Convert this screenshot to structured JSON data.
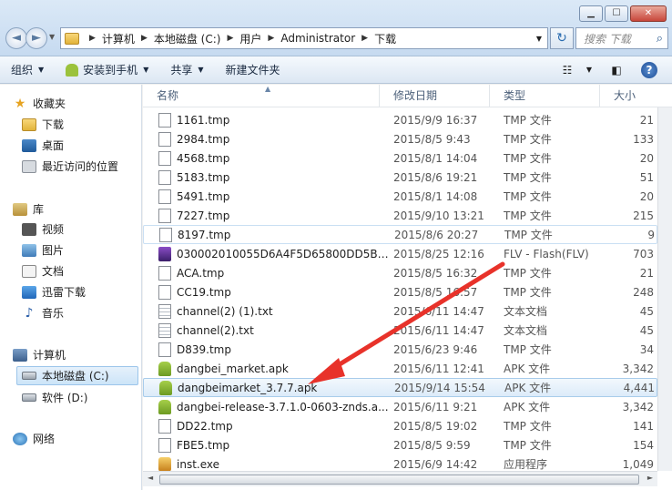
{
  "window": {
    "minimize": "▁",
    "maximize": "☐",
    "close": "✕"
  },
  "address": {
    "back_icon": "◄",
    "forward_icon": "►",
    "crumbs": [
      "计算机",
      "本地磁盘 (C:)",
      "用户",
      "Administrator",
      "下载"
    ],
    "separator": "▶",
    "dropdown": "▼",
    "refresh_icon": "↻",
    "search_placeholder": "搜索 下载",
    "search_icon": "⌕"
  },
  "toolbar": {
    "organize": "组织",
    "install_phone": "安装到手机",
    "share": "共享",
    "new_folder": "新建文件夹",
    "dropdown_arrow": "▼",
    "view_icon": "☷",
    "pane_icon": "◧",
    "help_icon": "?"
  },
  "sidebar": {
    "favorites": "收藏夹",
    "downloads": "下载",
    "desktop": "桌面",
    "recent": "最近访问的位置",
    "libraries": "库",
    "videos": "视频",
    "pictures": "图片",
    "documents": "文档",
    "xunlei": "迅雷下载",
    "music": "音乐",
    "computer": "计算机",
    "drive_c": "本地磁盘 (C:)",
    "drive_d": "软件 (D:)",
    "network": "网络",
    "star_icon": "★",
    "music_icon": "♪"
  },
  "columns": {
    "name": "名称",
    "date": "修改日期",
    "type": "类型",
    "size": "大小",
    "sort": "▲"
  },
  "files": [
    {
      "name": "1161.tmp",
      "date": "2015/9/9 16:37",
      "type": "TMP 文件",
      "size": "21",
      "icon": "tmp"
    },
    {
      "name": "2984.tmp",
      "date": "2015/8/5 9:43",
      "type": "TMP 文件",
      "size": "133",
      "icon": "tmp"
    },
    {
      "name": "4568.tmp",
      "date": "2015/8/1 14:04",
      "type": "TMP 文件",
      "size": "20",
      "icon": "tmp"
    },
    {
      "name": "5183.tmp",
      "date": "2015/8/6 19:21",
      "type": "TMP 文件",
      "size": "51",
      "icon": "tmp"
    },
    {
      "name": "5491.tmp",
      "date": "2015/8/1 14:08",
      "type": "TMP 文件",
      "size": "20",
      "icon": "tmp"
    },
    {
      "name": "7227.tmp",
      "date": "2015/9/10 13:21",
      "type": "TMP 文件",
      "size": "215",
      "icon": "tmp"
    },
    {
      "name": "8197.tmp",
      "date": "2015/8/6 20:27",
      "type": "TMP 文件",
      "size": "9",
      "icon": "tmp"
    },
    {
      "name": "030002010055D6A4F5D65800DD5B2...",
      "date": "2015/8/25 12:16",
      "type": "FLV - Flash(FLV)",
      "size": "703",
      "icon": "flv"
    },
    {
      "name": "ACA.tmp",
      "date": "2015/8/5 16:32",
      "type": "TMP 文件",
      "size": "21",
      "icon": "tmp"
    },
    {
      "name": "CC19.tmp",
      "date": "2015/8/5 16:57",
      "type": "TMP 文件",
      "size": "248",
      "icon": "tmp"
    },
    {
      "name": "channel(2) (1).txt",
      "date": "2015/6/11 14:47",
      "type": "文本文档",
      "size": "45",
      "icon": "txt"
    },
    {
      "name": "channel(2).txt",
      "date": "2015/6/11 14:47",
      "type": "文本文档",
      "size": "45",
      "icon": "txt"
    },
    {
      "name": "D839.tmp",
      "date": "2015/6/23 9:46",
      "type": "TMP 文件",
      "size": "34",
      "icon": "tmp"
    },
    {
      "name": "dangbei_market.apk",
      "date": "2015/6/11 12:41",
      "type": "APK 文件",
      "size": "3,342",
      "icon": "apk"
    },
    {
      "name": "dangbeimarket_3.7.7.apk",
      "date": "2015/9/14 15:54",
      "type": "APK 文件",
      "size": "4,441",
      "icon": "apk"
    },
    {
      "name": "dangbei-release-3.7.1.0-0603-znds.a...",
      "date": "2015/6/11 9:21",
      "type": "APK 文件",
      "size": "3,342",
      "icon": "apk"
    },
    {
      "name": "DD22.tmp",
      "date": "2015/8/5 19:02",
      "type": "TMP 文件",
      "size": "141",
      "icon": "tmp"
    },
    {
      "name": "FBE5.tmp",
      "date": "2015/8/5 9:59",
      "type": "TMP 文件",
      "size": "154",
      "icon": "tmp"
    },
    {
      "name": "inst.exe",
      "date": "2015/6/9 14:42",
      "type": "应用程序",
      "size": "1,049",
      "icon": "exe"
    }
  ],
  "highlighted_file": "dangbeimarket_3.7.7.apk",
  "annotation": {
    "arrow_color": "#e8322a"
  },
  "scroll": {
    "left": "◄",
    "right": "►"
  }
}
